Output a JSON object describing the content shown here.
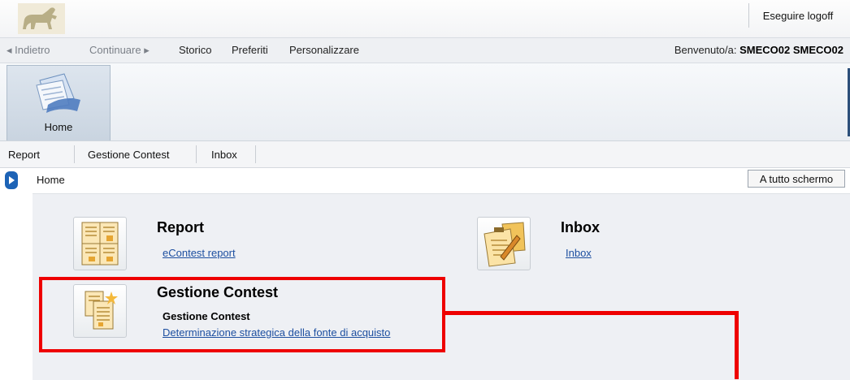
{
  "header": {
    "logoff_label": "Eseguire logoff"
  },
  "nav": {
    "back_label": "◂ Indietro",
    "forward_label": "Continuare ▸",
    "history_label": "Storico",
    "favorites_label": "Preferiti",
    "customize_label": "Personalizzare",
    "welcome_prefix": "Benvenuto/a:",
    "welcome_user": "SMECO02 SMECO02"
  },
  "ribbon": {
    "home_label": "Home"
  },
  "subnav": {
    "items": [
      "Report",
      "Gestione Contest",
      "Inbox"
    ]
  },
  "breadcrumb": {
    "current": "Home",
    "fullscreen_label": "A tutto schermo"
  },
  "tiles": {
    "report": {
      "title": "Report",
      "link": "eContest report"
    },
    "inbox": {
      "title": "Inbox",
      "link": "Inbox"
    },
    "gestione": {
      "title": "Gestione Contest",
      "subtitle": "Gestione Contest",
      "link": "Determinazione strategica della fonte di acquisto"
    }
  },
  "colors": {
    "highlight": "#ee0000",
    "link": "#1d4fa0",
    "accent": "#1d63b6"
  }
}
